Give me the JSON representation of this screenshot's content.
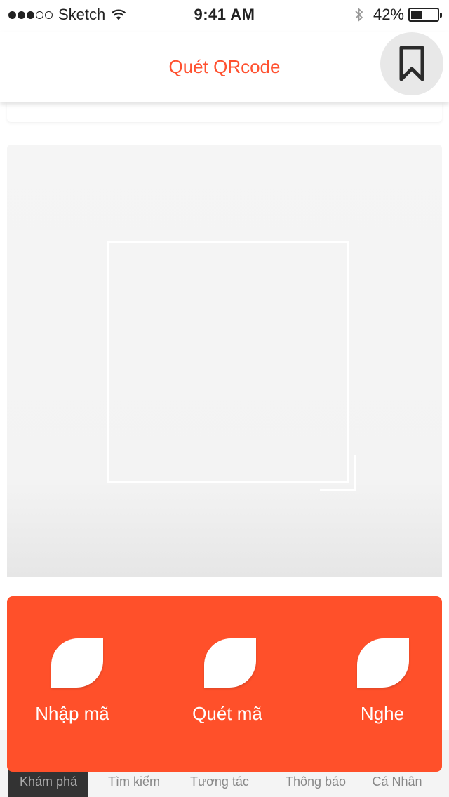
{
  "status_bar": {
    "carrier": "Sketch",
    "time": "9:41 AM",
    "battery_percent": "42%",
    "signal_bars_filled": 3,
    "signal_bars_total": 5,
    "battery_level": 0.42
  },
  "header": {
    "title": "Quét QRcode",
    "bookmark_icon": "bookmark-icon"
  },
  "actions": [
    {
      "label": "Nhập mã",
      "icon": "leaf-icon"
    },
    {
      "label": "Quét mã",
      "icon": "leaf-icon"
    },
    {
      "label": "Nghe",
      "icon": "leaf-icon"
    }
  ],
  "tabs": [
    {
      "label": "Khám phá",
      "active": true
    },
    {
      "label": "Tìm kiếm",
      "active": false
    },
    {
      "label": "Tương tác",
      "active": false
    },
    {
      "label": "Thông báo",
      "active": false
    },
    {
      "label": "Cá Nhân",
      "active": false
    }
  ],
  "colors": {
    "accent": "#ff5130",
    "action_panel": "#ff502a",
    "tab_active_bg": "#333333"
  }
}
